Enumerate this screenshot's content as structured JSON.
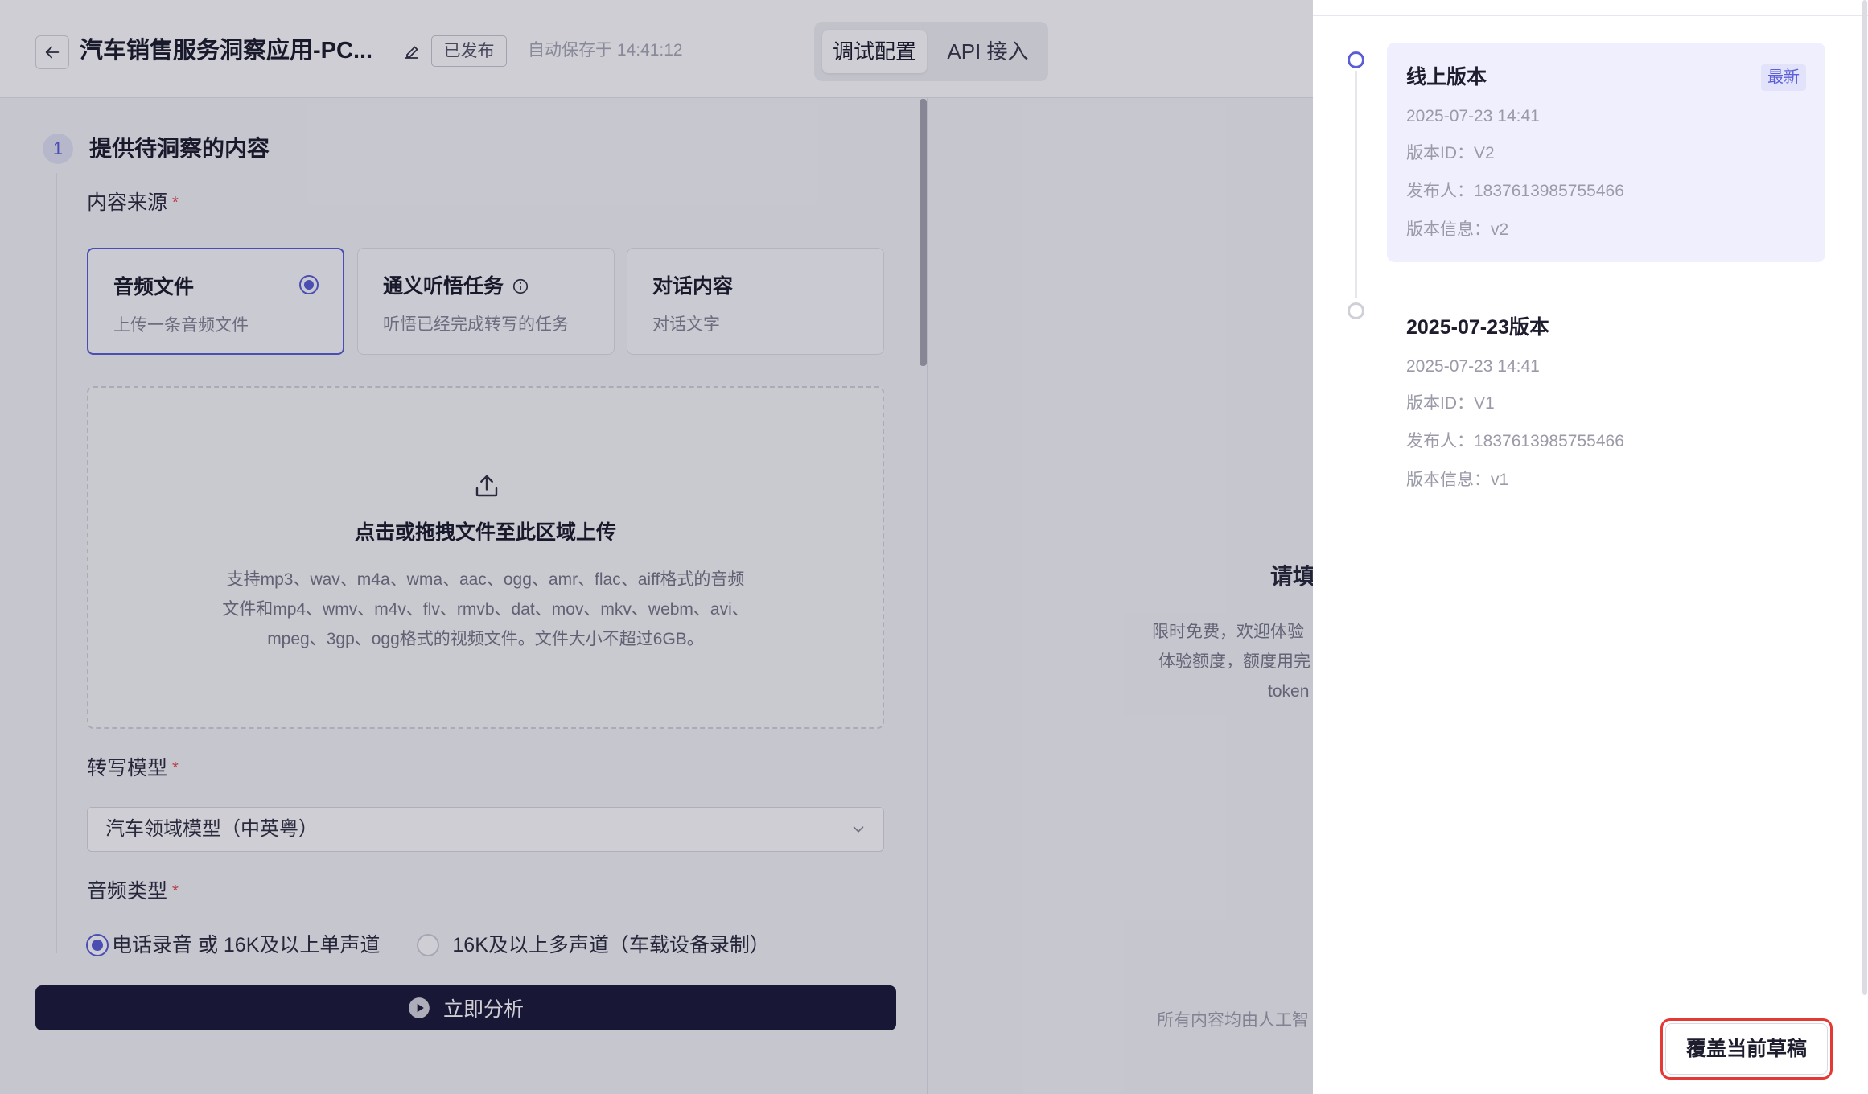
{
  "theme": {
    "accent": "#5b5fd6",
    "primary_button": "#1c1c3a",
    "required": "#e5484d",
    "highlight": "#e53935",
    "current_version_bg": "#efeffd"
  },
  "icons": {
    "back": "arrow-left-icon",
    "edit": "pencil-icon",
    "info": "info-circle-icon",
    "upload": "upload-icon",
    "select": "chevron-down-icon",
    "analyze": "play-circle-icon"
  },
  "header": {
    "title": "汽车销售服务洞察应用-PC...",
    "status_badge": "已发布",
    "autosave": "自动保存于 14:41:12",
    "tabs": [
      {
        "label": "调试配置",
        "active": true
      },
      {
        "label": "API 接入",
        "active": false
      }
    ]
  },
  "config": {
    "required_mark": "*",
    "step_number": "1",
    "step_title": "提供待洞察的内容",
    "source_label": "内容来源",
    "source_options": [
      {
        "title": "音频文件",
        "subtitle": "上传一条音频文件",
        "selected": true
      },
      {
        "title": "通义听悟任务",
        "subtitle": "听悟已经完成转写的任务",
        "selected": false
      },
      {
        "title": "对话内容",
        "subtitle": "对话文字",
        "selected": false
      }
    ],
    "upload": {
      "title": "点击或拖拽文件至此区域上传",
      "description_lines": [
        "支持mp3、wav、m4a、wma、aac、ogg、amr、flac、aiff格式的音频",
        "文件和mp4、wmv、m4v、flv、rmvb、dat、mov、mkv、webm、avi、",
        "mpeg、3gp、ogg格式的视频文件。文件大小不超过6GB。"
      ]
    },
    "model_label": "转写模型",
    "model_value": "汽车领域模型（中英粤）",
    "audio_type_label": "音频类型",
    "audio_types": [
      {
        "label": "电话录音 或 16K及以上单声道",
        "selected": true
      },
      {
        "label": "16K及以上多声道（车载设备录制）",
        "selected": false
      }
    ],
    "analyze_button": "立即分析"
  },
  "result_panel": {
    "title": "请填",
    "lines": [
      "限时免费，欢迎体验",
      "体验额度，额度用完",
      "token"
    ],
    "footer": "所有内容均由人工智"
  },
  "versions_drawer": {
    "versions": [
      {
        "title": "线上版本",
        "badge": "最新",
        "date": "2025-07-23 14:41",
        "version_id": "版本ID：V2",
        "publisher": "发布人：1837613985755466",
        "info": "版本信息：v2",
        "current": true
      },
      {
        "title": "2025-07-23版本",
        "date": "2025-07-23 14:41",
        "version_id": "版本ID：V1",
        "publisher": "发布人：1837613985755466",
        "info": "版本信息：v1",
        "current": false
      }
    ],
    "overwrite_button": "覆盖当前草稿"
  }
}
